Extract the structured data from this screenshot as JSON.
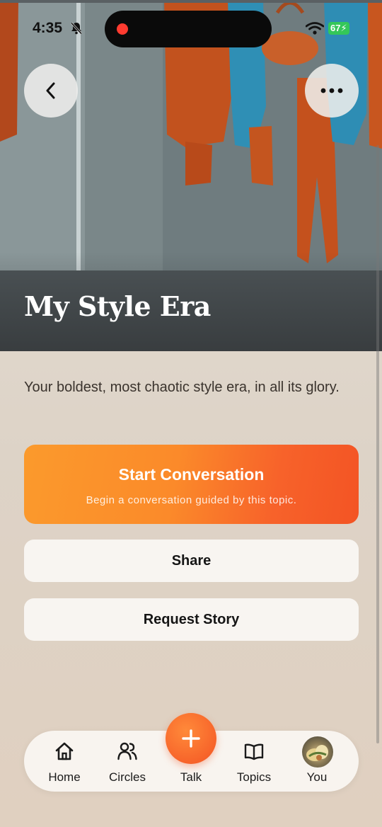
{
  "status_bar": {
    "time": "4:35",
    "battery": "67"
  },
  "hero": {
    "title": "My Style Era",
    "back_icon": "chevron-left-icon",
    "more_icon": "ellipsis-icon"
  },
  "content": {
    "description": "Your boldest, most chaotic style era, in all its glory.",
    "start_button": {
      "label": "Start Conversation",
      "subtitle": "Begin a conversation guided by this topic."
    },
    "share_label": "Share",
    "request_label": "Request Story"
  },
  "tabbar": {
    "items": [
      {
        "label": "Home",
        "icon": "home-icon"
      },
      {
        "label": "Circles",
        "icon": "people-icon"
      },
      {
        "label": "Talk",
        "icon": "plus-icon"
      },
      {
        "label": "Topics",
        "icon": "book-icon"
      },
      {
        "label": "You",
        "icon": "avatar"
      }
    ]
  },
  "colors": {
    "accent_start": "#fb9a2c",
    "accent_end": "#f35424",
    "button_bg": "#f8f5f1",
    "page_bg": "#e2d9ce"
  }
}
